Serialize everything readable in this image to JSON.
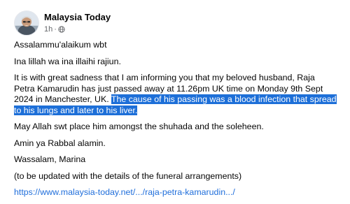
{
  "post": {
    "page_name": "Malaysia Today",
    "time": "1h",
    "separator": "·",
    "visibility_icon": "globe-icon",
    "greeting": "Assalammu'alaikum wbt",
    "line_condolence": "Ina lillah wa ina illaihi rajiun.",
    "announcement_plain": "It is with great sadness that I am informing you that my beloved husband, Raja Petra Kamarudin has just passed away at 11.26pm UK time on Monday 9th Sept 2024 in Manchester, UK.",
    "announcement_highlighted": "The cause of his passing was a blood infection that spread to his lungs and later to his liver.",
    "prayer": "May Allah swt place him amongst the shuhada and the soleheen.",
    "amin": "Amin ya Rabbal alamin.",
    "signoff": "Wassalam, Marina",
    "update_note": "(to be updated with the details of the funeral arrangements)",
    "link_text": "https://www.malaysia-today.net/.../raja-petra-kamarudin.../"
  },
  "colors": {
    "highlight_bg": "#1d6fd8",
    "link": "#216fdb",
    "meta_text": "#65676b",
    "body_text": "#050505"
  }
}
